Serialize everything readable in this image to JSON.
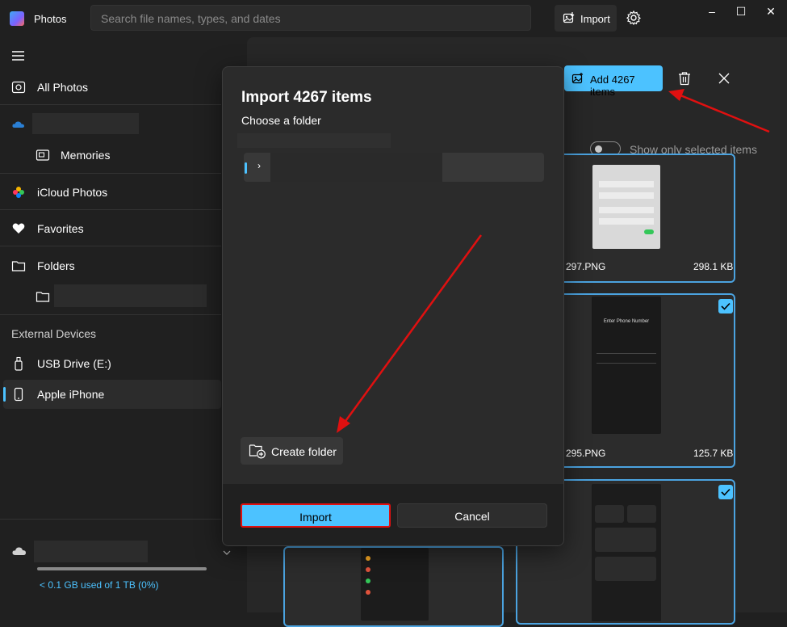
{
  "titlebar": {
    "app_title": "Photos",
    "search_placeholder": "Search file names, types, and dates",
    "import_label": "Import",
    "window_controls": [
      "–",
      "☐",
      "✕"
    ]
  },
  "sidebar": {
    "items": [
      {
        "label": "All Photos",
        "icon": "photos-icon"
      },
      {
        "label": "Memories",
        "icon": "memories-icon"
      },
      {
        "label": "iCloud Photos",
        "icon": "icloud-photos-icon"
      },
      {
        "label": "Favorites",
        "icon": "heart-icon"
      },
      {
        "label": "Folders",
        "icon": "folder-icon"
      }
    ],
    "external_devices_label": "External Devices",
    "devices": [
      {
        "label": "USB Drive (E:)",
        "icon": "usb-drive-icon"
      },
      {
        "label": "Apple iPhone",
        "icon": "phone-icon",
        "selected": true
      }
    ],
    "storage_text": "< 0.1 GB used of 1 TB (0%)"
  },
  "toolbar": {
    "add_label": "Add 4267 items",
    "toggle_label": "Show only selected items",
    "toggle_on": false
  },
  "cards": [
    {
      "filename": "297.PNG",
      "size": "298.1 KB"
    },
    {
      "filename": "295.PNG",
      "size": "125.7 KB"
    }
  ],
  "thumb_text": {
    "enter_phone": "Enter Phone Number"
  },
  "dialog": {
    "title": "Import 4267 items",
    "subtitle": "Choose a folder",
    "create_folder_label": "Create folder",
    "import_label": "Import",
    "cancel_label": "Cancel"
  },
  "colors": {
    "accent": "#4cc2ff",
    "annotation": "#e01010",
    "background": "#202020"
  }
}
